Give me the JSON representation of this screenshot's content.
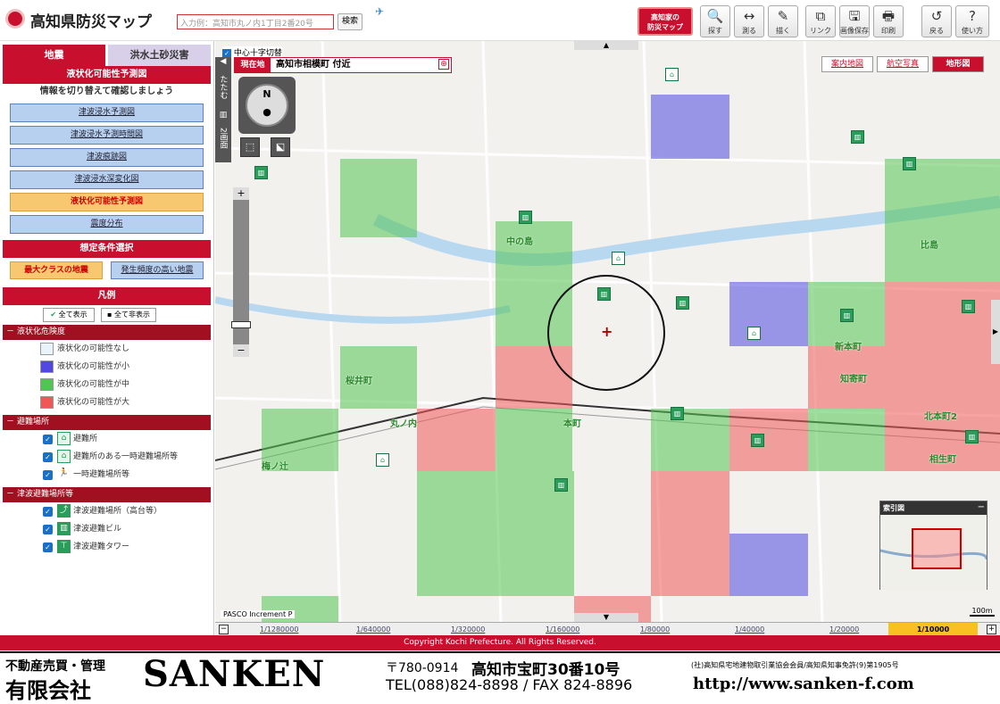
{
  "app": {
    "title": "高知県防災マップ",
    "search_placeholder": "入力例：高知市丸ノ内1丁目2番20号",
    "search_button": "検索"
  },
  "toolbar": {
    "home_btn_line1": "高知家の",
    "home_btn_line2": "防災マップ",
    "buttons": [
      {
        "icon": "🔍",
        "label": "探す"
      },
      {
        "icon": "↔",
        "label": "測る"
      },
      {
        "icon": "✎",
        "label": "描く"
      },
      {
        "icon": "⧉",
        "label": "リンク"
      },
      {
        "icon": "🖫",
        "label": "画像保存"
      },
      {
        "icon": "🖶",
        "label": "印刷"
      },
      {
        "icon": "↺",
        "label": "戻る"
      },
      {
        "icon": "?",
        "label": "使い方"
      }
    ]
  },
  "left_panel": {
    "tabs": [
      "地震",
      "洪水土砂災害"
    ],
    "section_title": "液状化可能性予測図",
    "instruction": "情報を切り替えて確認しましょう",
    "menu": [
      "津波浸水予測図",
      "津波浸水予測時間図",
      "津波痕跡図",
      "津波浸水深変化図",
      "液状化可能性予測図",
      "震度分布"
    ],
    "cond_title": "想定条件選択",
    "cond_buttons": [
      "最大クラスの地震",
      "発生頻度の高い地震"
    ],
    "legend_title": "凡例",
    "show_all": "全て表示",
    "hide_all": "全て非表示",
    "groups": [
      {
        "title": "液状化危険度",
        "items": [
          {
            "label": "液状化の可能性なし",
            "color": "#e8f4fa"
          },
          {
            "label": "液状化の可能性が小",
            "color": "#5048e0"
          },
          {
            "label": "液状化の可能性が中",
            "color": "#52c452"
          },
          {
            "label": "液状化の可能性が大",
            "color": "#f05858"
          }
        ]
      },
      {
        "title": "避難場所",
        "items": [
          {
            "label": "避難所"
          },
          {
            "label": "避難所のある一時避難場所等"
          },
          {
            "label": "一時避難場所等"
          }
        ]
      },
      {
        "title": "津波避難場所等",
        "items": [
          {
            "label": "津波避難場所（高台等）"
          },
          {
            "label": "津波避難ビル"
          },
          {
            "label": "津波避難タワー"
          }
        ]
      }
    ]
  },
  "map": {
    "crosshair_label": "中心十字切替",
    "collapse": "たたむ",
    "split": "2画面",
    "location_key": "現在地",
    "location": "高知市相模町 付近",
    "map_types": [
      "案内地図",
      "航空写真",
      "地形図"
    ],
    "labels": [
      "北本町2",
      "新本町",
      "比島",
      "桜井町",
      "相生町",
      "知寄町",
      "丸ノ内",
      "中の島",
      "本町",
      "梅ノ辻"
    ],
    "inset_title": "索引図",
    "attribution": "PASCO  Increment P",
    "scale_text": "100m"
  },
  "scale": {
    "values": [
      "1/1280000",
      "1/640000",
      "1/320000",
      "1/160000",
      "1/80000",
      "1/40000",
      "1/20000",
      "1/10000"
    ]
  },
  "footer": {
    "copyright": "Copyright Kochi Prefecture. All Rights Reserved."
  },
  "ad": {
    "line1": "不動産売買・管理",
    "line2": "有限会社",
    "company": "SANKEN",
    "postal": "〒780-0914",
    "address": "高知市宝町30番10号",
    "tel": "TEL(088)824-8898 / FAX 824-8896",
    "member": "(社)高知県宅地建物取引業協会会員/高知県知事免許(9)第1905号",
    "url": "http://www.sanken-f.com"
  }
}
